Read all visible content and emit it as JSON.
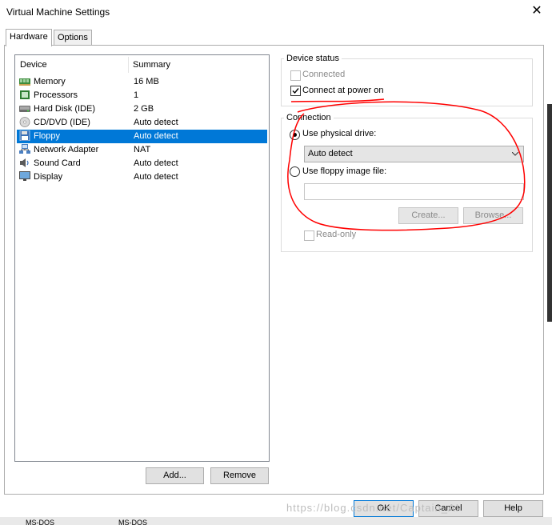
{
  "window": {
    "title": "Virtual Machine Settings",
    "close_glyph": "✕"
  },
  "tabs": [
    {
      "label": "Hardware",
      "active": true
    },
    {
      "label": "Options",
      "active": false
    }
  ],
  "device_list": {
    "columns": [
      "Device",
      "Summary"
    ],
    "rows": [
      {
        "device": "Memory",
        "summary": "16 MB",
        "icon": "memory-icon"
      },
      {
        "device": "Processors",
        "summary": "1",
        "icon": "processor-icon"
      },
      {
        "device": "Hard Disk (IDE)",
        "summary": "2 GB",
        "icon": "hard-disk-icon"
      },
      {
        "device": "CD/DVD (IDE)",
        "summary": "Auto detect",
        "icon": "cd-dvd-icon"
      },
      {
        "device": "Floppy",
        "summary": "Auto detect",
        "icon": "floppy-icon",
        "selected": true
      },
      {
        "device": "Network Adapter",
        "summary": "NAT",
        "icon": "network-adapter-icon"
      },
      {
        "device": "Sound Card",
        "summary": "Auto detect",
        "icon": "sound-card-icon"
      },
      {
        "device": "Display",
        "summary": "Auto detect",
        "icon": "display-icon"
      }
    ]
  },
  "buttons": {
    "add": "Add...",
    "remove": "Remove",
    "ok": "OK",
    "cancel": "Cancel",
    "help": "Help"
  },
  "device_status": {
    "label": "Device status",
    "connected": {
      "label": "Connected",
      "checked": false,
      "enabled": false
    },
    "connect_at_power_on": {
      "label": "Connect at power on",
      "checked": true,
      "enabled": true
    }
  },
  "connection": {
    "label": "Connection",
    "use_physical_drive": {
      "label": "Use physical drive:",
      "selected": true
    },
    "drive_value": "Auto detect",
    "use_image_file": {
      "label": "Use floppy image file:",
      "selected": false
    },
    "image_path": "",
    "create_button": "Create...",
    "browse_button": "Browse...",
    "read_only": {
      "label": "Read-only",
      "checked": false,
      "enabled": false
    }
  },
  "watermark": "https://blog.csdn.net/Captain_AI",
  "background_taskbar": [
    "MS-DOS",
    "MS-DOS"
  ],
  "colors": {
    "selection": "#0078d7",
    "annotation": "#ff0000"
  }
}
